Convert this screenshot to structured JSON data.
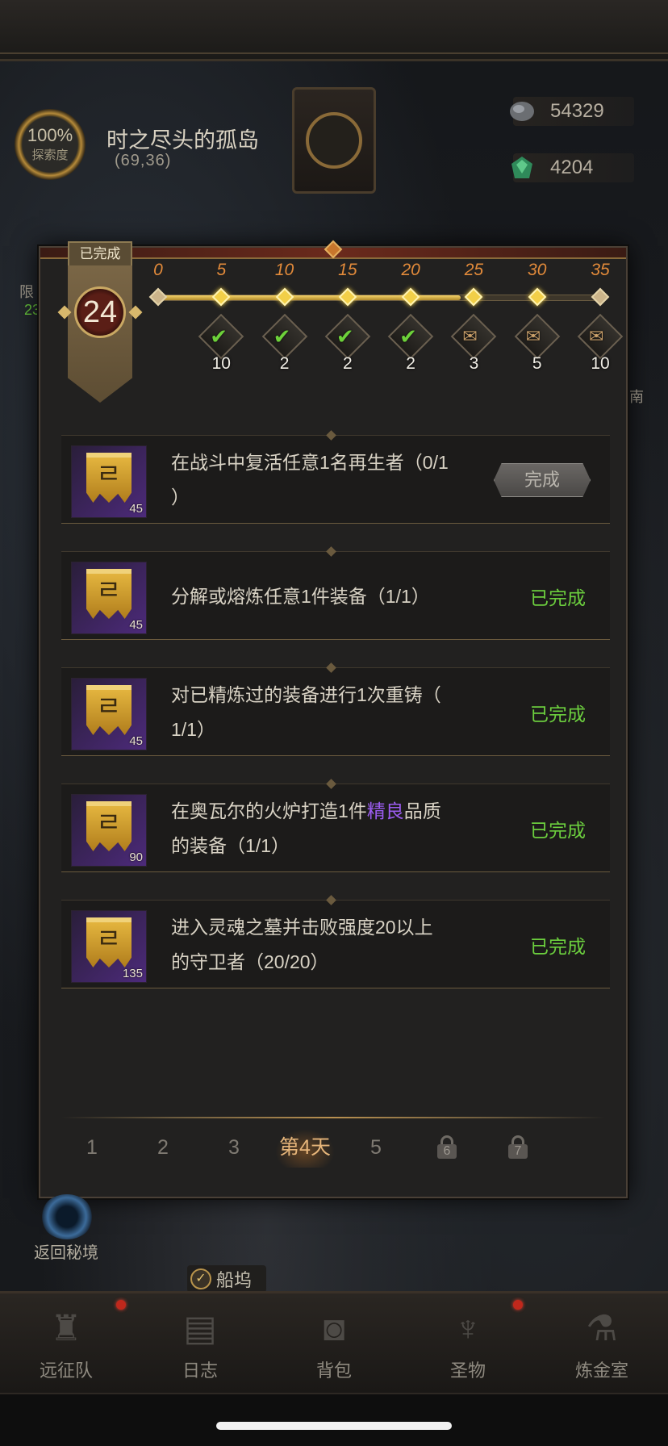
{
  "header": {
    "explore_pct": "100%",
    "explore_label": "探索度",
    "map_title": "时之尽头的孤岛",
    "coords": "(69,36)",
    "gold_icon": "ore-icon",
    "gold": "54329",
    "gem_icon": "emerald-icon",
    "gems": "4204"
  },
  "side": {
    "left_1": "限",
    "left_2": "23",
    "right_1": "南"
  },
  "panel": {
    "banner_status": "已完成",
    "points": "24",
    "progress": {
      "current": 24,
      "max": 35,
      "ticks": [
        "0",
        "5",
        "10",
        "15",
        "20",
        "25",
        "30",
        "35"
      ],
      "rewards": [
        {
          "at": 5,
          "icon": "claimed-check-icon",
          "count": "10"
        },
        {
          "at": 10,
          "icon": "claimed-check-icon",
          "count": "2"
        },
        {
          "at": 15,
          "icon": "claimed-check-icon",
          "count": "2"
        },
        {
          "at": 20,
          "icon": "claimed-check-icon",
          "count": "2"
        },
        {
          "at": 25,
          "icon": "scroll-icon",
          "count": "3"
        },
        {
          "at": 30,
          "icon": "scroll-icon",
          "count": "5"
        },
        {
          "at": 35,
          "icon": "scroll-icon",
          "count": "10"
        }
      ]
    },
    "tasks": [
      {
        "level": "45",
        "text_a": "在战斗中复活任意1名再生者（0/1",
        "text_b": "）",
        "button": "完成"
      },
      {
        "level": "45",
        "text_a": "分解或熔炼任意1件装备（1/1）",
        "status": "已完成"
      },
      {
        "level": "45",
        "text_a": "对已精炼过的装备进行1次重铸（",
        "text_b": "1/1）",
        "status": "已完成"
      },
      {
        "level": "90",
        "text_a": "在奥瓦尔的火炉打造1件",
        "highlight": "精良",
        "text_c": "品质",
        "text_b": "的装备（1/1）",
        "status": "已完成"
      },
      {
        "level": "135",
        "text_a": "进入灵魂之墓并击败强度20以上",
        "text_b": "的守卫者（20/20）",
        "status": "已完成"
      }
    ],
    "tabs": [
      "1",
      "2",
      "3",
      "第4天",
      "5",
      "6",
      "7"
    ]
  },
  "below": {
    "portal_label": "返回秘境",
    "dock_label": "船坞"
  },
  "nav": [
    {
      "label": "远征队",
      "icon": "helmet-icon"
    },
    {
      "label": "日志",
      "icon": "journal-icon"
    },
    {
      "label": "背包",
      "icon": "backpack-icon"
    },
    {
      "label": "圣物",
      "icon": "relic-icon"
    },
    {
      "label": "炼金室",
      "icon": "alchemy-icon"
    }
  ],
  "colors": {
    "accent_orange": "#e28a3a",
    "complete_green": "#6ccf3e",
    "quality_purple": "#9b5cf0",
    "progress_gold": "#f2cf48"
  }
}
